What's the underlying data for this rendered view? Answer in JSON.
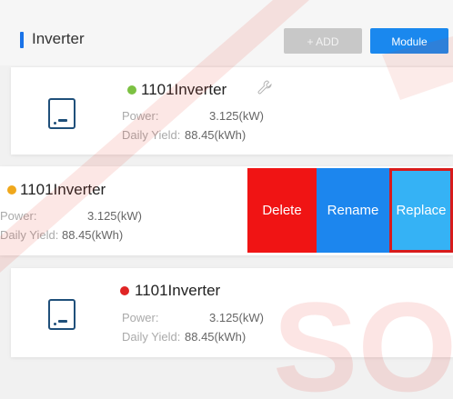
{
  "header": {
    "title": "Inverter",
    "add_label": "+ ADD",
    "module_label": "Module"
  },
  "devices": [
    {
      "name": "1101Inverter",
      "status_color": "#7cc142",
      "power_label": "Power:",
      "power_value": "3.125(kW)",
      "yield_label": "Daily Yield:",
      "yield_value": "88.45(kWh)",
      "icon": "inverter-icon",
      "settings_icon": "wrench-icon"
    },
    {
      "name": "1101Inverter",
      "status_color": "#f0a81c",
      "power_label": "Power:",
      "power_value": "3.125(kW)",
      "yield_label": "Daily Yield:",
      "yield_value": "88.45(kWh)"
    },
    {
      "name": "1101Inverter",
      "status_color": "#e02424",
      "power_label": "Power:",
      "power_value": "3.125(kW)",
      "yield_label": "Daily Yield:",
      "yield_value": "88.45(kWh)",
      "icon": "inverter-icon"
    }
  ],
  "swipe_actions": {
    "delete_label": "Delete",
    "rename_label": "Rename",
    "replace_label": "Replace"
  },
  "colors": {
    "accent": "#1a88ee",
    "delete": "#f01414",
    "replace": "#35b2f5"
  }
}
